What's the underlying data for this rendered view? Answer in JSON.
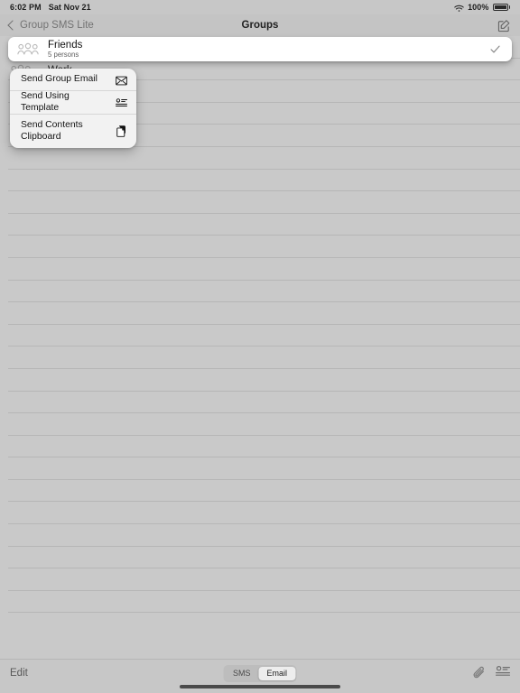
{
  "status_bar": {
    "time": "6:02 PM",
    "date": "Sat Nov 21",
    "battery_percent": "100%",
    "wifi_icon": "wifi-icon",
    "battery_icon": "battery-icon"
  },
  "nav_bar": {
    "back_label": "Group SMS Lite",
    "back_icon": "chevron-left-icon",
    "title": "Groups",
    "compose_icon": "compose-icon"
  },
  "dragged_group": {
    "name": "Friends",
    "subtitle": "5 persons",
    "group_icon": "group-people-icon",
    "check_icon": "checkmark-icon",
    "selected": true
  },
  "list": {
    "rows": [
      {
        "name": "Work",
        "group_icon": "group-people-icon"
      }
    ],
    "empty_row_count": 26
  },
  "context_menu": {
    "items": [
      {
        "label": "Send Group Email",
        "icon": "envelope-icon"
      },
      {
        "label": "Send Using Template",
        "icon": "contact-card-icon"
      },
      {
        "label": "Send Contents\nClipboard",
        "icon": "clipboard-copy-icon"
      }
    ]
  },
  "toolbar": {
    "edit_label": "Edit",
    "segments": [
      {
        "label": "SMS",
        "selected": false
      },
      {
        "label": "Email",
        "selected": true
      }
    ],
    "attach_icon": "paperclip-icon",
    "contacts_icon": "contact-card-icon"
  },
  "colors": {
    "screen_background": "#c9c9c9",
    "chrome_background": "#c7c7c7",
    "card_background": "#ffffff",
    "menu_background": "#f2f2f2",
    "separator": "#b6b6b6",
    "text_primary": "#1d1d1d",
    "text_secondary": "#5d5d5d",
    "disabled_text": "#737373"
  }
}
